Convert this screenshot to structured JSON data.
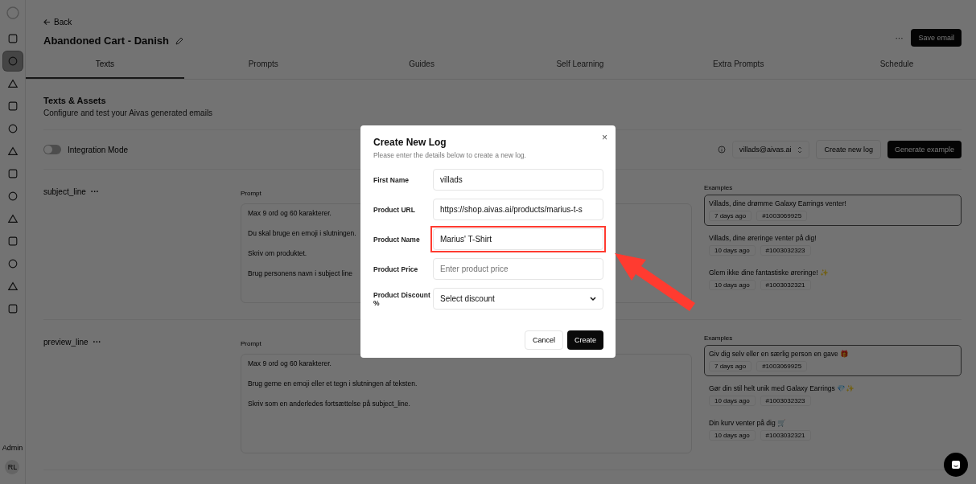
{
  "sidebar": {
    "items": [
      {
        "selected": false
      },
      {
        "selected": true
      },
      {
        "selected": false
      },
      {
        "selected": false
      },
      {
        "selected": false
      },
      {
        "selected": false
      },
      {
        "selected": false
      },
      {
        "selected": false
      },
      {
        "selected": false
      },
      {
        "selected": false
      },
      {
        "selected": false
      },
      {
        "selected": false
      },
      {
        "selected": false
      }
    ],
    "role": "Admin",
    "avatar_initials": "RL"
  },
  "header": {
    "back": "Back",
    "title": "Abandoned Cart - Danish",
    "more": "···",
    "save": "Save email"
  },
  "tabs": [
    {
      "label": "Texts",
      "selected": true
    },
    {
      "label": "Prompts",
      "selected": false
    },
    {
      "label": "Guides",
      "selected": false
    },
    {
      "label": "Self Learning",
      "selected": false
    },
    {
      "label": "Extra Prompts",
      "selected": false
    },
    {
      "label": "Schedule",
      "selected": false
    }
  ],
  "section": {
    "title": "Texts & Assets",
    "subtitle": "Configure and test your Aivas generated emails"
  },
  "toolbar": {
    "integration_label": "Integration Mode",
    "integration_on": false,
    "account": "villads@aivas.ai",
    "create_log": "Create new log",
    "generate": "Generate example"
  },
  "blocks": [
    {
      "name": "subject_line",
      "menu": "···",
      "prompt_label": "Prompt",
      "prompt_lines": [
        "Max 9 ord og 60 karakterer.",
        "Du skal bruge en emoji i slutningen.",
        "Skriv om produktet.",
        "Brug personens navn i subject line"
      ],
      "examples_label": "Examples",
      "examples": [
        {
          "text": "Villads, dine drømme Galaxy Earrings venter!",
          "age": "7 days ago",
          "order": "#1003069925",
          "selected": true
        },
        {
          "text": "Villads, dine øreringe venter på dig!",
          "age": "10 days ago",
          "order": "#1003032323",
          "selected": false
        },
        {
          "text": "Glem ikke dine fantastiske øreringe! ✨",
          "age": "10 days ago",
          "order": "#1003032321",
          "selected": false
        }
      ]
    },
    {
      "name": "preview_line",
      "menu": "···",
      "prompt_label": "Prompt",
      "prompt_lines": [
        "Max 9 ord og 60 karakterer.",
        "Brug gerne en emoji eller et tegn i slutningen af teksten.",
        "Skriv som en anderledes fortsættelse på subject_line."
      ],
      "examples_label": "Examples",
      "examples": [
        {
          "text": "Giv dig selv eller en særlig person en gave 🎁",
          "age": "7 days ago",
          "order": "#1003069925",
          "selected": true
        },
        {
          "text": "Gør din stil helt unik med Galaxy Earrings 💎✨",
          "age": "10 days ago",
          "order": "#1003032323",
          "selected": false
        },
        {
          "text": "Din kurv venter på dig 🛒",
          "age": "10 days ago",
          "order": "#1003032321",
          "selected": false
        }
      ]
    }
  ],
  "modal": {
    "title": "Create New Log",
    "subtitle": "Please enter the details below to create a new log.",
    "close": "×",
    "fields": [
      {
        "kind": "text",
        "label": "First Name",
        "value": "villads",
        "highlighted": false
      },
      {
        "kind": "text",
        "label": "Product URL",
        "value": "https://shop.aivas.ai/products/marius-t-s",
        "highlighted": false
      },
      {
        "kind": "text",
        "label": "Product Name",
        "value": "Marius' T-Shirt",
        "highlighted": true
      },
      {
        "kind": "text",
        "label": "Product Price",
        "placeholder": "Enter product price",
        "highlighted": false
      },
      {
        "kind": "select",
        "label": "Product Discount %",
        "value": "Select discount",
        "highlighted": false
      }
    ],
    "cancel": "Cancel",
    "create": "Create"
  }
}
